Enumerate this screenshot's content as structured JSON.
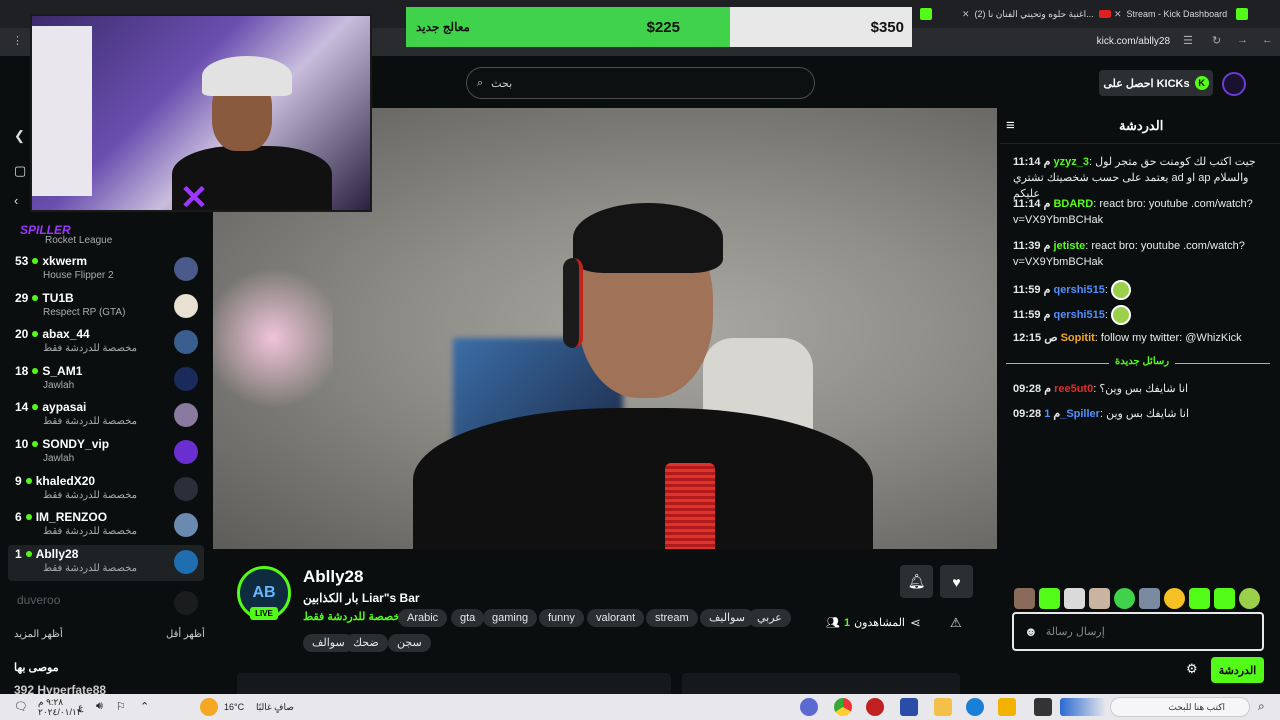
{
  "browser": {
    "tabs": [
      {
        "label": "Stream - Kick Dashboard",
        "icon": "kick-icon"
      },
      {
        "label": "(2) اغنية حلوه وتحيني الفنان نا...",
        "icon": "youtube-icon"
      }
    ],
    "url": "kick.com/ablly28"
  },
  "alert": {
    "name": "معالج جديد",
    "current": "$225",
    "goal": "$350",
    "progress_fraction": 0.64
  },
  "header": {
    "search_placeholder": "بحث",
    "get_kicks": "احصل على KICKs"
  },
  "sidebar": {
    "partial_top": {
      "category": "Rocket League",
      "name": "SPILLER"
    },
    "channels": [
      {
        "viewers": "53",
        "name": "xkwerm",
        "category": "House Flipper 2",
        "color": "#4a5a8a"
      },
      {
        "viewers": "29",
        "name": "TU1B",
        "category": "Respect RP (GTA)",
        "color": "#e8e0d0"
      },
      {
        "viewers": "20",
        "name": "abax_44",
        "category": "مخصصة للدردشة فقط",
        "color": "#3a5f8f"
      },
      {
        "viewers": "18",
        "name": "S_AM1",
        "category": "Jawlah",
        "color": "#1a2a5a"
      },
      {
        "viewers": "14",
        "name": "aypasai",
        "category": "مخصصة للدردشة فقط",
        "color": "#8a7aa0"
      },
      {
        "viewers": "10",
        "name": "SONDY_vip",
        "category": "Jawlah",
        "color": "#6b2fd0"
      },
      {
        "viewers": "9",
        "name": "khaledX20",
        "category": "مخصصة للدردشة فقط",
        "color": "#2a2f3a"
      },
      {
        "viewers": "6",
        "name": "IM_RENZOO",
        "category": "مخصصة للدردشة فقط",
        "color": "#6a8ab0"
      },
      {
        "viewers": "1",
        "name": "Ablly28",
        "category": "مخصصة للدردشة فقط",
        "color": "#1f6fb0"
      }
    ],
    "offline": {
      "name": "duveroo"
    },
    "show_more": "أظهر المزيد",
    "show_less": "أظهر أقل",
    "recommended": "موصى بها",
    "recommended_item": {
      "viewers": "392",
      "name": "Hyperfate88"
    }
  },
  "stream": {
    "channel": "Ablly28",
    "avatar_text": "AB",
    "live": "LIVE",
    "title": "بار الكذابين Liar\"s Bar",
    "category": "مخصصة للدردشة فقط",
    "tags": [
      "عربي",
      "سواليف",
      "stream",
      "valorant",
      "funny",
      "gaming",
      "gta",
      "Arabic",
      "سجن",
      "ضحك",
      "سوالف"
    ],
    "viewers_label": "المشاهدون",
    "viewers": "1"
  },
  "chat": {
    "title": "الدردشة",
    "messages": [
      {
        "time": "11:14 م",
        "user": "yzyz_3",
        "color": "#53fc18",
        "text": "جيت اكتب لك كومنت حق متجر لول يعتمد على حسب شخصيتك تشتري ad او ap والسلام عليكم"
      },
      {
        "time": "11:14 م",
        "user": "BDARD",
        "color": "#53fc18",
        "text": "react bro: youtube .com/watch?v=VX9YbmBCHak"
      },
      {
        "time": "11:39 م",
        "user": "jetiste",
        "color": "#53fc18",
        "text": "react bro: youtube .com/watch?v=VX9YbmBCHak"
      },
      {
        "time": "11:59 م",
        "user": "qershi515",
        "color": "#4f8fff",
        "text": ""
      },
      {
        "time": "11:59 م",
        "user": "qershi515",
        "color": "#4f8fff",
        "text": ""
      },
      {
        "time": "12:15 ص",
        "user": "Sopitit",
        "color": "#f5a623",
        "text": "follow my twitter: @WhizKick"
      },
      {
        "time": "09:28 م",
        "user": "ree5ut0",
        "color": "#e02b2b",
        "text": "انا شايفك بس وين؟"
      },
      {
        "time": "09:28 م",
        "user": "1_Spiller",
        "color": "#4f8fff",
        "text": "انا شايفك بس وين"
      }
    ],
    "new_messages": "رسائل جديدة",
    "input_placeholder": "إرسال رسالة",
    "send": "الدردشة"
  },
  "taskbar": {
    "weather": "صافٍ غالبًا",
    "temp": "16°C",
    "search": "اكتب هنا للبحث",
    "time": "٩:٢٨ م",
    "date": "٢٠٢٤/٠١/١٣",
    "lang": "ع"
  }
}
